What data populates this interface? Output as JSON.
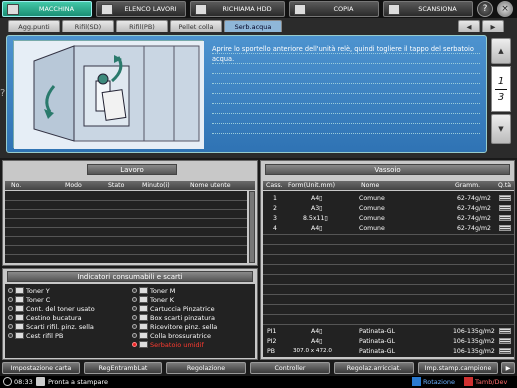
{
  "top_tabs": [
    {
      "label": "MACCHINA",
      "active": true
    },
    {
      "label": "ELENCO LAVORI",
      "active": false
    },
    {
      "label": "RICHIAMA HDD",
      "active": false
    },
    {
      "label": "COPIA",
      "active": false
    },
    {
      "label": "SCANSIONA",
      "active": false
    }
  ],
  "top_buttons": {
    "help": "?",
    "close": "×"
  },
  "sub_tabs": [
    "Agg.punti",
    "Rifil(SD)",
    "Rifil(PB)",
    "Pellet colla",
    "Serb.acqua"
  ],
  "sub_tab_active": "Serb.acqua",
  "sub_nav": {
    "prev": "◀",
    "next": "▶"
  },
  "help_mark": "?",
  "message": "Aprire lo sportello anteriore dell'unità relè, quindi togliere il tappo del serbatoio acqua.",
  "pager": {
    "up": "▲",
    "current": "1",
    "total": "3",
    "down": "▼"
  },
  "lavoro": {
    "title": "Lavoro",
    "columns": [
      "No.",
      "Modo",
      "Stato",
      "Minuto(i)",
      "Nome utente"
    ],
    "rows": []
  },
  "vassoio": {
    "title": "Vassoio",
    "columns": [
      "Cass.",
      "Form(Unit.mm)",
      "Nome",
      "Gramm.",
      "Q.tà"
    ],
    "rows": [
      {
        "cass": "1",
        "form": "A4▯",
        "nome": "Comune",
        "gramm": "62-74g/m2"
      },
      {
        "cass": "2",
        "form": "A3▯",
        "nome": "Comune",
        "gramm": "62-74g/m2"
      },
      {
        "cass": "3",
        "form": "8.5x11▯",
        "nome": "Comune",
        "gramm": "62-74g/m2"
      },
      {
        "cass": "4",
        "form": "A4▯",
        "nome": "Comune",
        "gramm": "62-74g/m2"
      }
    ],
    "rows2": [
      {
        "cass": "PI1",
        "form": "A4▯",
        "nome": "Patinata-GL",
        "gramm": "106-135g/m2"
      },
      {
        "cass": "PI2",
        "form": "A4▯",
        "nome": "Patinata-GL",
        "gramm": "106-135g/m2"
      },
      {
        "cass": "PB",
        "form": "307.0 x 472.0",
        "nome": "Patinata-GL",
        "gramm": "106-135g/m2"
      }
    ]
  },
  "consumables": {
    "title": "Indicatori consumabili e scarti",
    "left": [
      {
        "label": "Toner Y",
        "state": "ok"
      },
      {
        "label": "Toner C",
        "state": "ok"
      },
      {
        "label": "Cont. del toner usato",
        "state": "ok"
      },
      {
        "label": "Cestino bucatura",
        "state": "ok"
      },
      {
        "label": "Scarti rifil. pinz. sella",
        "state": "ok"
      },
      {
        "label": "Cest rifil PB",
        "state": "ok"
      }
    ],
    "right": [
      {
        "label": "Toner M",
        "state": "ok"
      },
      {
        "label": "Toner K",
        "state": "ok"
      },
      {
        "label": "Cartuccia Pinzatrice",
        "state": "ok"
      },
      {
        "label": "Box scarti pinzatura",
        "state": "ok"
      },
      {
        "label": "Ricevitore pinz. sella",
        "state": "ok"
      },
      {
        "label": "Colla brossuratrice",
        "state": "ok"
      },
      {
        "label": "Serbatoio umidif",
        "state": "error"
      }
    ]
  },
  "bottom_buttons": [
    "Impostazione carta",
    "RegEntrambLat",
    "Regolazione",
    "Controller",
    "Regolaz.arricciat.",
    "Imp.stamp.campione"
  ],
  "bottom_next": "▶",
  "status": {
    "time": "08:33",
    "message": "Pronta a stampare",
    "rotation": "Rotazione",
    "mode": "Tamb/Dev"
  },
  "colors": {
    "accent": "#1b8f74",
    "info_blue": "#3a80c0",
    "error": "#ff3b30"
  }
}
